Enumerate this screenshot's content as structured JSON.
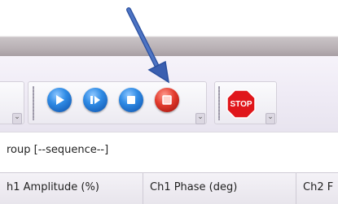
{
  "window": {
    "title": ""
  },
  "toolbar": {
    "buttons": [
      {
        "name": "play-button",
        "icon": "play-icon",
        "color": "#1f78d1"
      },
      {
        "name": "step-button",
        "icon": "step-icon",
        "color": "#1f78d1"
      },
      {
        "name": "stop-blue-button",
        "icon": "square-stop-icon",
        "color": "#1f78d1"
      },
      {
        "name": "stop-red-button",
        "icon": "square-stop-icon",
        "color": "#d62b22"
      }
    ],
    "stop_label": "STOP",
    "stop_color": "#e0161b"
  },
  "group": {
    "label": "roup [--sequence--]"
  },
  "table": {
    "columns": [
      "h1 Amplitude (%)",
      "Ch1 Phase (deg)",
      "Ch2 F"
    ]
  },
  "annotation": {
    "icon": "arrow-icon",
    "color": "#3a5fb0"
  }
}
